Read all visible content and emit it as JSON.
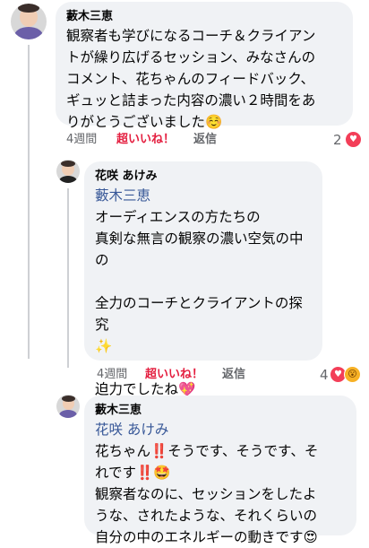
{
  "comments": [
    {
      "author": "藪木三恵",
      "body": "観察者も学びになるコーチ＆クライアン\nトが繰り広げるセッション、みなさんの\nコメント、花ちゃんのフィードバック、\nギュッと詰まった内容の濃い２時間をあ\nりがとうございました☺️",
      "time": "4週間",
      "reaction_label": "超いいね！",
      "reply_label": "返信",
      "reaction_count": "2"
    },
    {
      "author": "花咲 あけみ",
      "mention": "藪木三恵",
      "body": "\nオーディエンスの方たちの\n真剣な無言の観察の濃い空気の中の\n\n全力のコーチとクライアントの探究\n✨\n\n迫力でしたね💖",
      "time": "4週間",
      "reaction_label": "超いいね！",
      "reply_label": "返信",
      "reaction_count": "4"
    },
    {
      "author": "藪木三恵",
      "mention": "花咲 あけみ",
      "body": "花ちゃん‼️そうです、そうです、そ\nれです‼️🤩\n観察者なのに、セッションをしたよ\nうな、されたような、それくらいの\n自分の中のエネルギーの動きです😍"
    }
  ],
  "colors": {
    "bubble_bg": "#f0f2f5",
    "mention": "#385898",
    "super_like": "#e41e3f",
    "meta": "#65676b"
  },
  "icons": {
    "reaction_1": "heart-icon",
    "reaction_2": [
      "heart-icon",
      "wow-icon"
    ]
  }
}
